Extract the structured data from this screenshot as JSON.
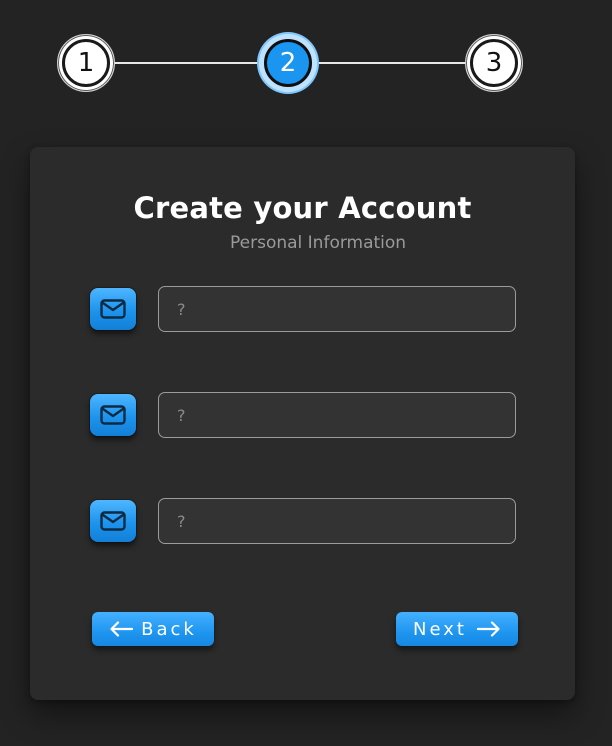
{
  "stepper": {
    "steps": [
      {
        "label": "1",
        "state": "done"
      },
      {
        "label": "2",
        "state": "active"
      },
      {
        "label": "3",
        "state": "upcoming"
      }
    ],
    "colors": {
      "active": "#1a95f0",
      "inactive": "#ffffff",
      "line": "#e8e8e8"
    }
  },
  "card": {
    "title": "Create your Account",
    "subtitle": "Personal Information"
  },
  "fields": [
    {
      "icon": "mail-icon",
      "placeholder": "?",
      "value": ""
    },
    {
      "icon": "mail-icon",
      "placeholder": "?",
      "value": ""
    },
    {
      "icon": "mail-icon",
      "placeholder": "?",
      "value": ""
    }
  ],
  "buttons": {
    "back_label": "Back",
    "next_label": "Next",
    "back_icon": "arrow-left-icon",
    "next_icon": "arrow-right-icon",
    "accent": "#1e96f0"
  }
}
